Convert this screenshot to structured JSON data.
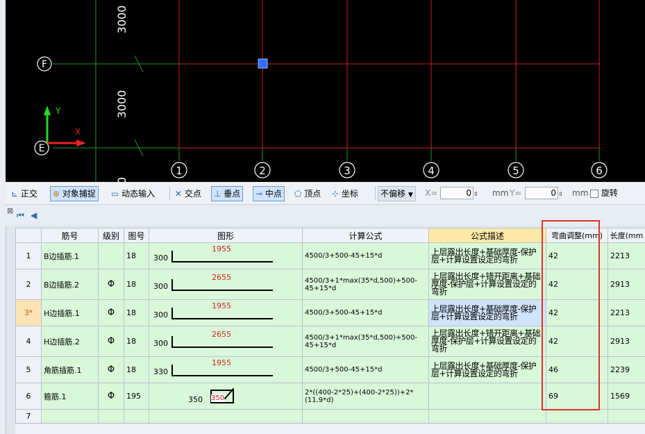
{
  "canvas": {
    "dim_labels": [
      "3000",
      "3000",
      "0"
    ],
    "axis": {
      "x": "X",
      "y": "Y"
    },
    "grid_rows": [
      "F",
      "E"
    ],
    "grid_cols": [
      "1",
      "2",
      "3",
      "4",
      "5",
      "6"
    ],
    "colors": {
      "background": "#000000",
      "grid_line": "#cc2020",
      "axis_line": "#1a9a1a",
      "bubble": "#ffffff",
      "selected_point": "#2f6fff"
    }
  },
  "toolbar": {
    "ortho": "正交",
    "object_snap": "对象捕捉",
    "dynamic_input": "动态输入",
    "intersection": "交点",
    "perpendicular": "垂点",
    "midpoint": "中点",
    "vertex": "顶点",
    "coordinate": "坐标",
    "offset_select": "不偏移",
    "x_label": "X=",
    "x_value": "0",
    "y_label": "Y=",
    "y_value": "0",
    "unit": "mm",
    "rotate": "旋转"
  },
  "table": {
    "headers": [
      "",
      "筋号",
      "级别",
      "图号",
      "图形",
      "计算公式",
      "公式描述",
      "弯曲调整(mm)",
      "长度(mm"
    ],
    "rows": [
      {
        "idx": "1",
        "name": "B边插筋.1",
        "grade": "",
        "fig": "18",
        "shape_left": "300",
        "shape_top": "1955",
        "shape_type": "L",
        "formula": "4500/3+500-45+15*d",
        "desc": "上层露出长度+基础厚度-保护层+计算设置设定的弯折",
        "bend": "42",
        "length": "2213"
      },
      {
        "idx": "2",
        "name": "B边插筋.2",
        "grade": "Φ",
        "fig": "18",
        "shape_left": "300",
        "shape_top": "2655",
        "shape_type": "L",
        "formula": "4500/3+1*max(35*d,500)+500-45+15*d",
        "desc": "上层露出长度+错开距离+基础厚度-保护层+计算设置设定的弯折",
        "bend": "42",
        "length": "2913"
      },
      {
        "idx": "3*",
        "name": "H边插筋.1",
        "grade": "Φ",
        "fig": "18",
        "shape_left": "300",
        "shape_top": "1955",
        "shape_type": "L",
        "formula": "4500/3+500-45+15*d",
        "desc": "上层露出长度+基础厚度-保护层+计算设置设定的弯折",
        "bend": "42",
        "length": "2213"
      },
      {
        "idx": "4",
        "name": "H边插筋.2",
        "grade": "Φ",
        "fig": "18",
        "shape_left": "300",
        "shape_top": "2655",
        "shape_type": "L",
        "formula": "4500/3+1*max(35*d,500)+500-45+15*d",
        "desc": "上层露出长度+错开距离+基础厚度-保护层+计算设置设定的弯折",
        "bend": "42",
        "length": "2913"
      },
      {
        "idx": "5",
        "name": "角筋插筋.1",
        "grade": "Φ",
        "fig": "18",
        "shape_left": "330",
        "shape_top": "1955",
        "shape_type": "L",
        "formula": "4500/3+500-45+15*d",
        "desc": "上层露出长度+基础厚度-保护层+计算设置设定的弯折",
        "bend": "46",
        "length": "2239"
      },
      {
        "idx": "6",
        "name": "箍筋.1",
        "grade": "Φ",
        "fig": "195",
        "shape_left": "350",
        "shape_top": "350",
        "shape_type": "box",
        "formula": "2*((400-2*25)+(400-2*25))+2*(11.9*d)",
        "desc": "",
        "bend": "69",
        "length": "1569"
      },
      {
        "idx": "7",
        "name": "",
        "grade": "",
        "fig": "",
        "shape_left": "",
        "shape_top": "",
        "shape_type": "",
        "formula": "",
        "desc": "",
        "bend": "",
        "length": ""
      }
    ]
  }
}
